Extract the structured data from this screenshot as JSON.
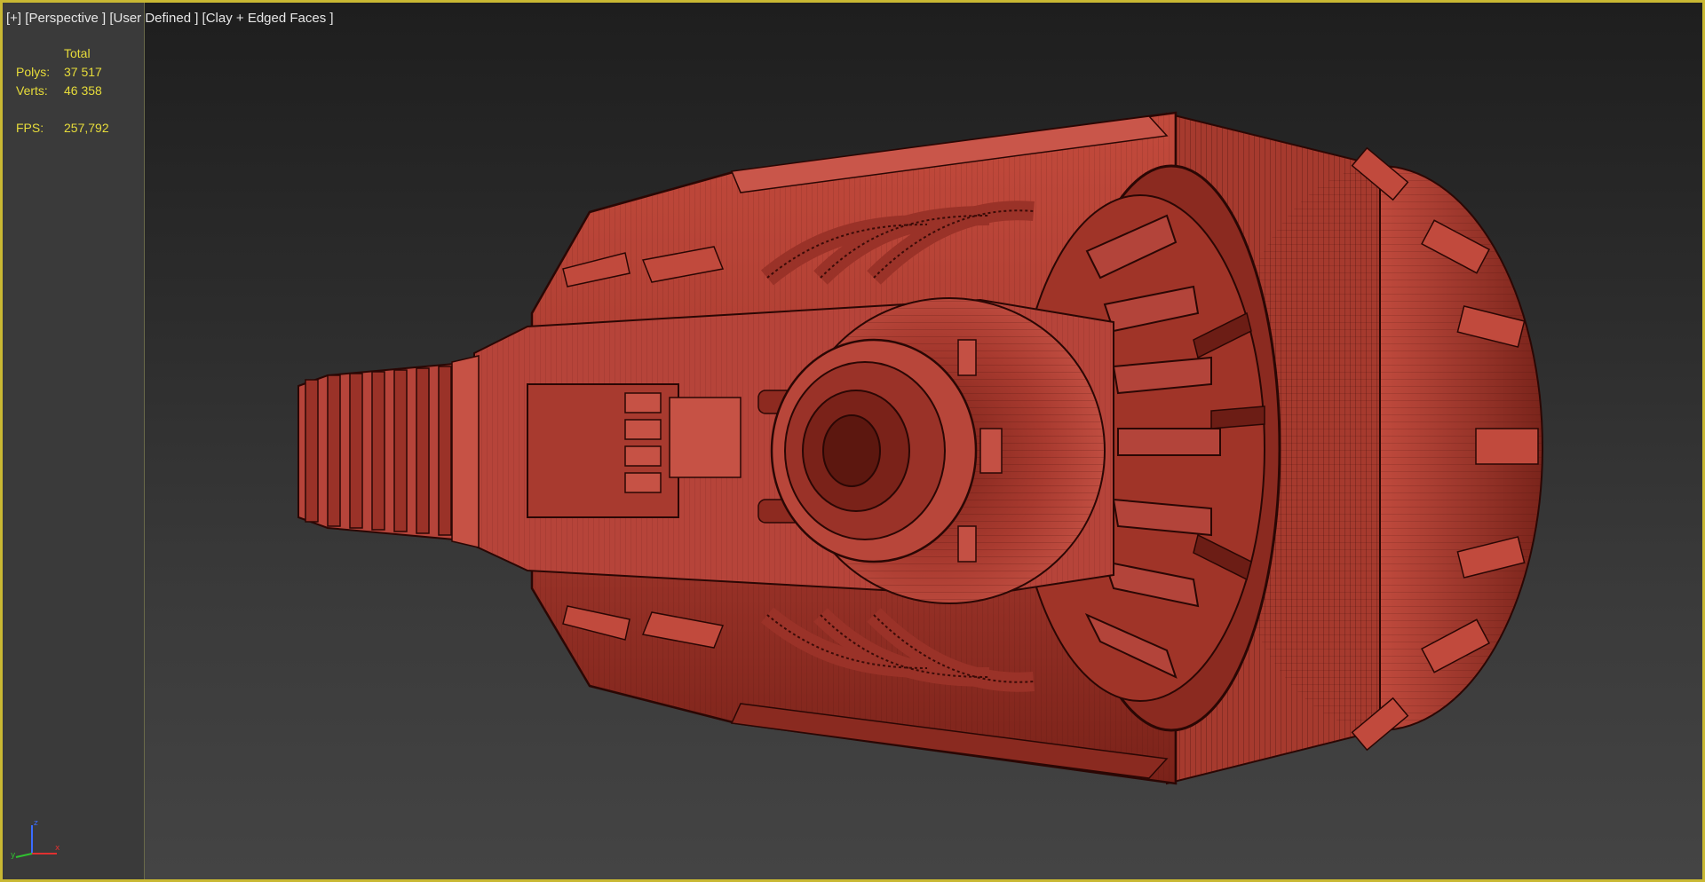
{
  "viewport": {
    "label_plus": "[+]",
    "label_view": "[Perspective ]",
    "label_user": "[User Defined ]",
    "label_shading": "[Clay + Edged Faces ]"
  },
  "stats": {
    "header": "Total",
    "polys_label": "Polys:",
    "polys_value": "37 517",
    "verts_label": "Verts:",
    "verts_value": "46 358",
    "fps_label": "FPS:",
    "fps_value": "257,792"
  },
  "gizmo": {
    "x_label": "x",
    "y_label": "y",
    "z_label": "z"
  },
  "colors": {
    "frame_border": "#c9b833",
    "stats_text": "#e7dc3a",
    "model_base": "#b84437",
    "model_dark": "#6a1c15"
  }
}
